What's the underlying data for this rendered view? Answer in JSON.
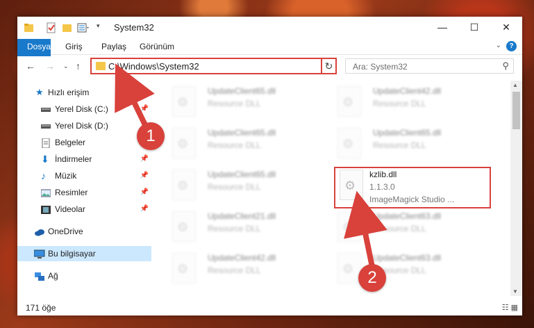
{
  "window": {
    "title": "System32"
  },
  "ribbon": {
    "tabs": [
      "Dosya",
      "Giriş",
      "Paylaş",
      "Görünüm"
    ],
    "help": "?"
  },
  "address": {
    "path": "C:\\Windows\\System32"
  },
  "search": {
    "placeholder": "Ara: System32"
  },
  "sidebar": {
    "items": [
      {
        "label": "Hızlı erişim"
      },
      {
        "label": "Yerel Disk (C:)"
      },
      {
        "label": "Yerel Disk (D:)"
      },
      {
        "label": "Belgeler"
      },
      {
        "label": "İndirmeler"
      },
      {
        "label": "Müzik"
      },
      {
        "label": "Resimler"
      },
      {
        "label": "Videolar"
      },
      {
        "label": "OneDrive"
      },
      {
        "label": "Bu bilgisayar"
      },
      {
        "label": "Ağ"
      }
    ]
  },
  "files": [
    {
      "name": "UpdateClient65.dll",
      "desc": "Resource DLL"
    },
    {
      "name": "UpdateClient42.dll",
      "desc": "Resource DLL"
    },
    {
      "name": "UpdateClient65.dll",
      "desc": "Resource DLL"
    },
    {
      "name": "UpdateClient65.dll",
      "desc": "Resource DLL"
    },
    {
      "name": "UpdateClient65.dll",
      "desc": "Resource DLL"
    },
    {
      "name": "kzlib.dll",
      "version": "1.1.3.0",
      "company": "ImageMagick Studio ..."
    },
    {
      "name": "UpdateClient21.dll",
      "desc": "Resource DLL"
    },
    {
      "name": "UpdateClient63.dll",
      "desc": "Resource DLL"
    },
    {
      "name": "UpdateClient42.dll",
      "desc": "Resource DLL"
    },
    {
      "name": "UpdateClient63.dll",
      "desc": "Resource DLL"
    }
  ],
  "status": {
    "count": "171 öğe"
  },
  "callouts": [
    "1",
    "2"
  ],
  "colors": {
    "accent": "#1979ca",
    "highlight": "#d9413b",
    "selected": "#cce8ff"
  }
}
